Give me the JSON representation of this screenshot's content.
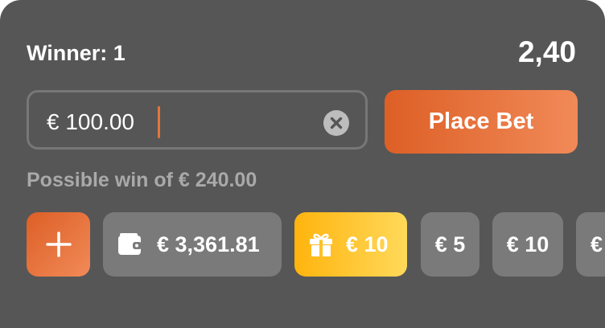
{
  "market": {
    "selection_label": "Winner: 1",
    "odds": "2,40"
  },
  "stake": {
    "value": "€ 100.00",
    "clear_icon": "close-circle-icon"
  },
  "place_bet_label": "Place Bet",
  "possible_win": "Possible win of € 240.00",
  "quick_chips": {
    "add_icon": "plus-icon",
    "wallet_icon": "wallet-icon",
    "wallet_balance": "€ 3,361.81",
    "bonus_icon": "gift-icon",
    "bonus_amount": "€ 10",
    "amount_5": "€ 5",
    "amount_10": "€ 10",
    "amount_more": "€"
  },
  "colors": {
    "panel_bg": "#565656",
    "accent_orange": "#dd5f26",
    "bonus_yellow": "#ffb40e",
    "chip_grey": "#7a7a7a",
    "caret": "#e6733d"
  }
}
